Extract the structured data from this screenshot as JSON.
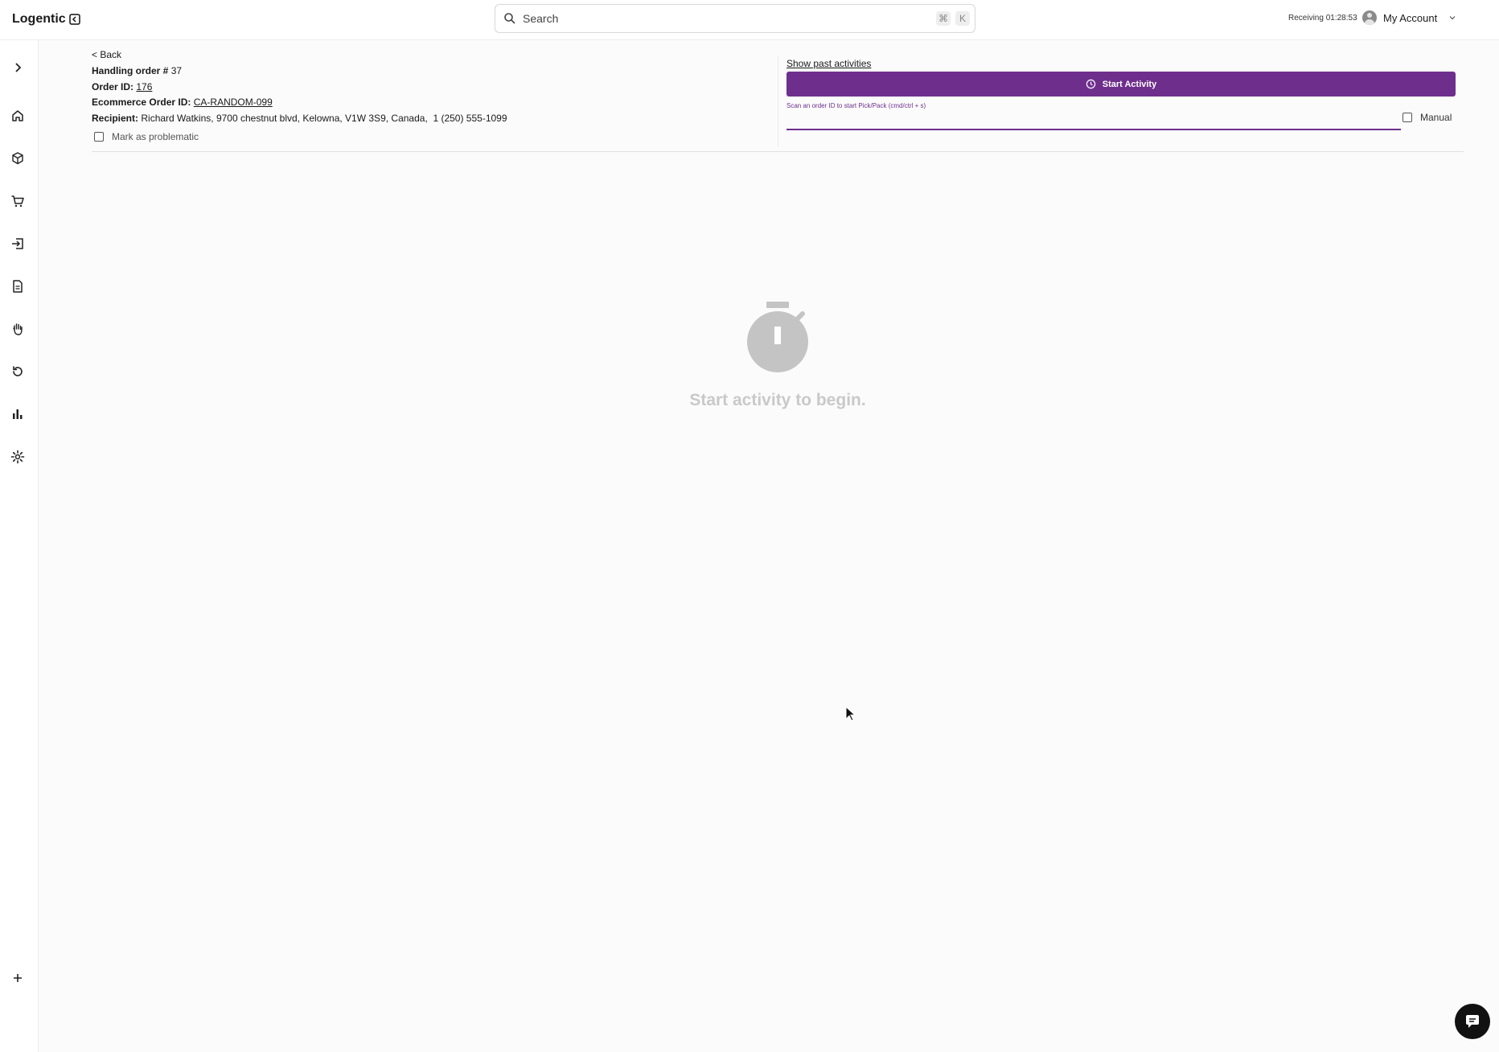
{
  "app": {
    "name": "Logentic"
  },
  "search": {
    "placeholder": "Search",
    "shortcut_mod": "⌘",
    "shortcut_key": "K"
  },
  "header": {
    "status_label": "Receiving",
    "timer": "01:28:53",
    "account_label": "My Account"
  },
  "order": {
    "back_label": "< Back",
    "handling_label": "Handling order #",
    "handling_value": "37",
    "order_id_label": "Order ID:",
    "order_id_value": "176",
    "ecom_label": "Ecommerce Order ID:",
    "ecom_value": "CA-RANDOM-099",
    "recipient_label": "Recipient:",
    "recipient_value": "Richard Watkins, 9700 chestnut blvd, Kelowna, V1W 3S9, Canada,  1 (250) 555-1099",
    "problematic_label": "Mark as problematic"
  },
  "activity": {
    "past_link": "Show past activities",
    "start_label": "Start Activity",
    "scan_label": "Scan an order ID to start Pick/Pack (cmd/ctrl + s)",
    "scan_value": "",
    "manual_label": "Manual",
    "empty_text": "Start activity to begin."
  },
  "sidebar": {
    "items": [
      "chevron-right-icon",
      "home-icon",
      "package-icon",
      "cart-icon",
      "inbound-icon",
      "document-icon",
      "hand-icon",
      "returns-icon",
      "analytics-icon",
      "settings-icon"
    ],
    "bottom": "plus-icon"
  },
  "colors": {
    "accent": "#6e2f8c",
    "empty_text": "#c9c9c9",
    "timer_icon": "#c4c4c4"
  }
}
